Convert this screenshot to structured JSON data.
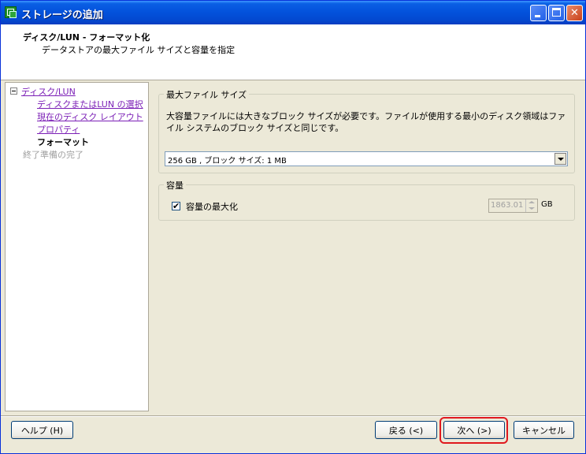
{
  "window": {
    "title": "ストレージの追加"
  },
  "header": {
    "title": "ディスク/LUN - フォーマット化",
    "subtitle": "データストアの最大ファイル サイズと容量を指定"
  },
  "nav": {
    "root": "ディスク/LUN",
    "items": [
      {
        "label": "ディスクまたはLUN の選択",
        "state": "link"
      },
      {
        "label": "現在のディスク レイアウト",
        "state": "link"
      },
      {
        "label": "プロパティ",
        "state": "link"
      },
      {
        "label": "フォーマット",
        "state": "current"
      }
    ],
    "final": "終了準備の完了"
  },
  "max_file_size": {
    "legend": "最大ファイル サイズ",
    "description": "大容量ファイルには大きなブロック サイズが必要です。ファイルが使用する最小のディスク領域はファイル システムのブロック サイズと同じです。",
    "selected": "256 GB , ブロック サイズ: 1 MB"
  },
  "capacity": {
    "legend": "容量",
    "checkbox_label": "容量の最大化",
    "checkbox_mark": "✔",
    "checked": true,
    "value": "1863.01",
    "unit": "GB"
  },
  "footer": {
    "help": "ヘルプ (H)",
    "back": "戻る (<)",
    "next": "次へ (>)",
    "cancel": "キャンセル"
  },
  "colors": {
    "highlight": "#e0191e",
    "titlebar": "#0351db"
  }
}
